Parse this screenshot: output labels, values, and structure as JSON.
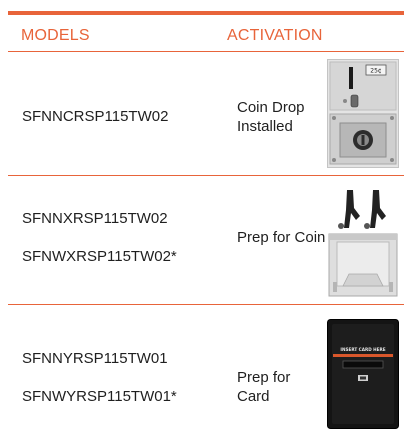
{
  "header": {
    "models_label": "MODELS",
    "activation_label": "ACTIVATION"
  },
  "colors": {
    "accent": "#e8643a",
    "text": "#1f1f1f"
  },
  "rows": [
    {
      "models": [
        "SFNNCRSP115TW02"
      ],
      "activation": "Coin Drop Installed",
      "image_icon": "coin-drop-mechanism-icon",
      "image_label": "25¢"
    },
    {
      "models": [
        "SFNNXRSP115TW02",
        "SFNWXRSP115TW02*"
      ],
      "activation": "Prep for Coin",
      "image_icon": "coin-prep-bracket-icon"
    },
    {
      "models": [
        "SFNNYRSP115TW01",
        "SFNWYRSP115TW01*"
      ],
      "activation": "Prep for Card",
      "image_icon": "card-reader-panel-icon",
      "image_label": "INSERT CARD HERE"
    }
  ]
}
